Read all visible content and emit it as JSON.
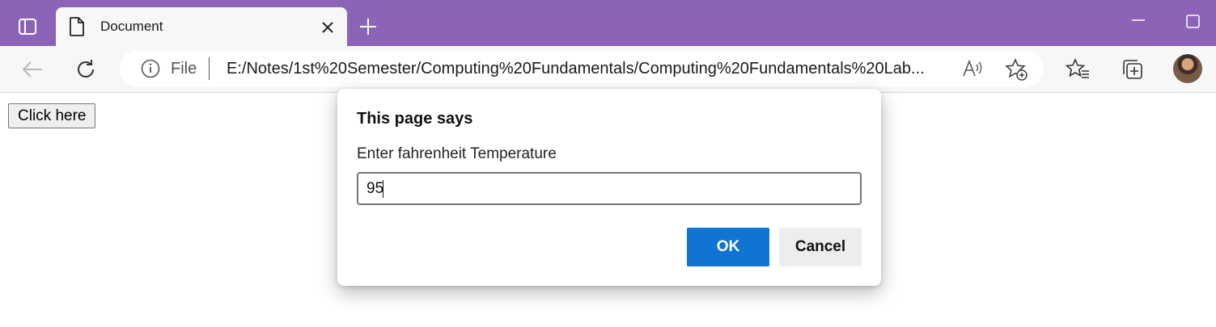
{
  "browser": {
    "tab": {
      "title": "Document"
    },
    "address": {
      "scheme_label": "File",
      "url": "E:/Notes/1st%20Semester/Computing%20Fundamentals/Computing%20Fundamentals%20Lab..."
    },
    "colors": {
      "tabstrip": "#8b63b7",
      "toolbar": "#f7f7f7",
      "accent": "#0f74d2"
    },
    "icons": [
      "tab-actions-icon",
      "page-icon",
      "close-icon",
      "new-tab-icon",
      "minimize-icon",
      "maximize-icon",
      "back-icon",
      "refresh-icon",
      "info-icon",
      "read-aloud-icon",
      "add-favorite-icon",
      "favorites-icon",
      "collections-icon",
      "avatar"
    ]
  },
  "page": {
    "button_label": "Click here"
  },
  "dialog": {
    "heading": "This page says",
    "message": "Enter fahrenheit Temperature",
    "input_value": "95",
    "ok_label": "OK",
    "cancel_label": "Cancel"
  }
}
